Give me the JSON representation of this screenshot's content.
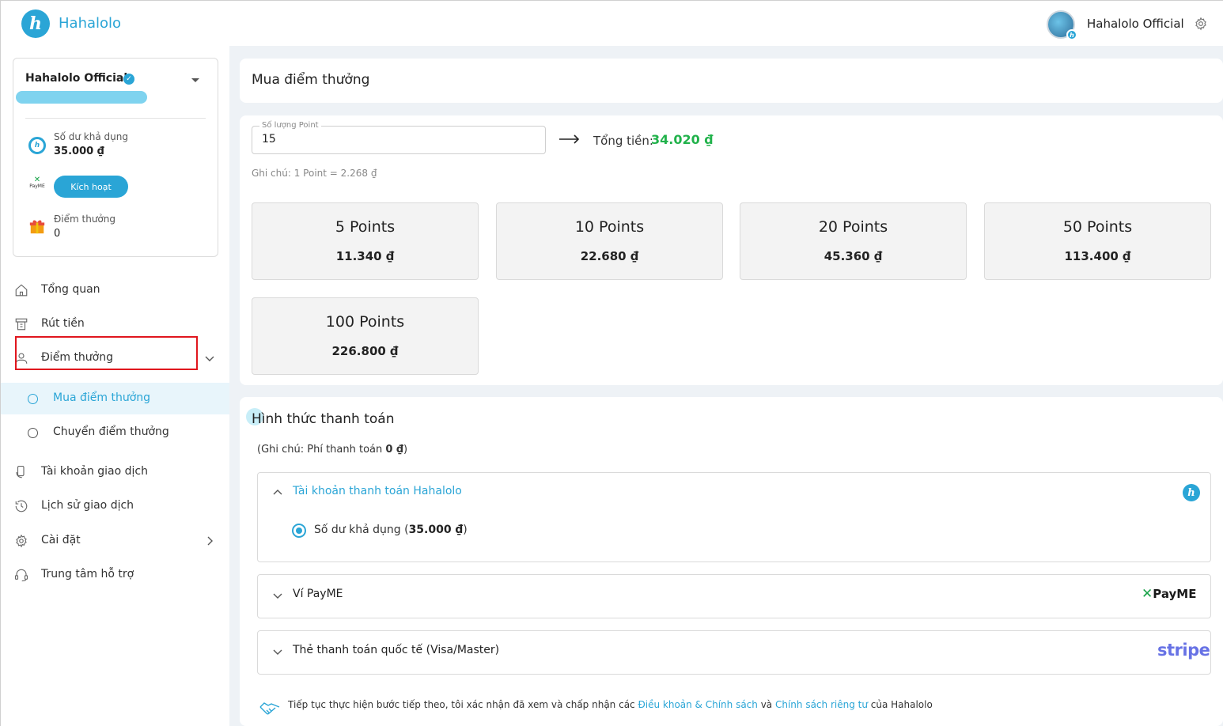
{
  "header": {
    "logo_text": "Hahalolo",
    "logo_glyph": "h",
    "user_name": "Hahalolo Official"
  },
  "sidebar": {
    "account": {
      "name": "Hahalolo Official",
      "balance_label": "Số dư khả dụng",
      "balance_value": "35.000 ₫",
      "payme_label": "PayME",
      "activate_label": "Kích hoạt",
      "points_label": "Điểm thưởng",
      "points_value": "0"
    },
    "nav": [
      {
        "label": "Tổng quan",
        "icon": "home-icon"
      },
      {
        "label": "Rút tiền",
        "icon": "withdraw-icon"
      },
      {
        "label": "Điểm thưởng",
        "icon": "reward-icon"
      },
      {
        "label": "Tài khoản giao dịch",
        "icon": "transaction-account-icon"
      },
      {
        "label": "Lịch sử giao dịch",
        "icon": "history-icon"
      },
      {
        "label": "Cài đặt",
        "icon": "gear-icon"
      },
      {
        "label": "Trung tâm hỗ trợ",
        "icon": "support-icon"
      }
    ],
    "sub_nav": [
      {
        "label": "Mua điểm thưởng",
        "active": true
      },
      {
        "label": "Chuyển điểm thưởng",
        "active": false
      }
    ]
  },
  "main": {
    "title": "Mua điểm thưởng",
    "quantity": {
      "legend": "Số lượng Point",
      "value": "15"
    },
    "total_label": "Tổng tiền:",
    "total_value": "34.020 ₫",
    "note": "Ghi chú: 1 Point = 2.268 ₫",
    "packages": [
      {
        "title": "5 Points",
        "price": "11.340 ₫"
      },
      {
        "title": "10 Points",
        "price": "22.680 ₫"
      },
      {
        "title": "20 Points",
        "price": "45.360 ₫"
      },
      {
        "title": "50 Points",
        "price": "113.400 ₫"
      },
      {
        "title": "100 Points",
        "price": "226.800 ₫"
      }
    ],
    "payment": {
      "title": "Hình thức thanh toán",
      "note_prefix": "(Ghi chú: Phí thanh toán ",
      "note_fee": "0 ₫",
      "note_suffix": ")",
      "methods": [
        {
          "title": "Tài khoản thanh toán Hahalolo",
          "logo": "h"
        },
        {
          "title": "Ví PayME",
          "logo": "PayME"
        },
        {
          "title": "Thẻ thanh toán quốc tế (Visa/Master)",
          "logo": "stripe"
        }
      ],
      "option_label": "Số dư khả dụng (",
      "option_value": "35.000 ₫",
      "option_suffix": ")",
      "consent_text": "Tiếp tục thực hiện bước tiếp theo, tôi xác nhận đã xem và chấp nhận các ",
      "consent_link1": "Điều khoản & Chính sách",
      "consent_and": " và ",
      "consent_link2": "Chính sách riêng tư",
      "consent_end": " của Hahalolo"
    }
  },
  "colors": {
    "brand": "#2aa5d6",
    "total": "#21b24b",
    "highlight": "#e0161e",
    "stripe": "#6772e5"
  }
}
